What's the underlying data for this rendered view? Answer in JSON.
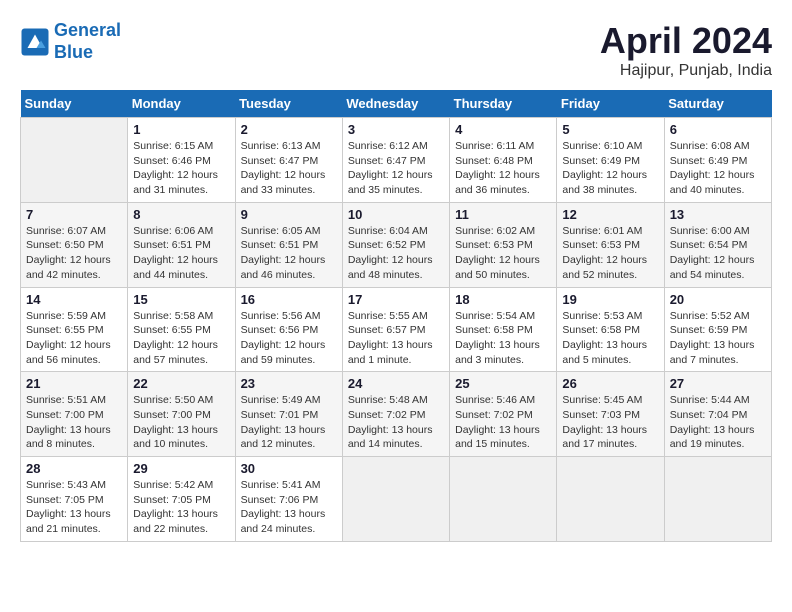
{
  "logo": {
    "line1": "General",
    "line2": "Blue"
  },
  "title": "April 2024",
  "location": "Hajipur, Punjab, India",
  "days_header": [
    "Sunday",
    "Monday",
    "Tuesday",
    "Wednesday",
    "Thursday",
    "Friday",
    "Saturday"
  ],
  "weeks": [
    [
      {
        "num": "",
        "content": ""
      },
      {
        "num": "1",
        "content": "Sunrise: 6:15 AM\nSunset: 6:46 PM\nDaylight: 12 hours\nand 31 minutes."
      },
      {
        "num": "2",
        "content": "Sunrise: 6:13 AM\nSunset: 6:47 PM\nDaylight: 12 hours\nand 33 minutes."
      },
      {
        "num": "3",
        "content": "Sunrise: 6:12 AM\nSunset: 6:47 PM\nDaylight: 12 hours\nand 35 minutes."
      },
      {
        "num": "4",
        "content": "Sunrise: 6:11 AM\nSunset: 6:48 PM\nDaylight: 12 hours\nand 36 minutes."
      },
      {
        "num": "5",
        "content": "Sunrise: 6:10 AM\nSunset: 6:49 PM\nDaylight: 12 hours\nand 38 minutes."
      },
      {
        "num": "6",
        "content": "Sunrise: 6:08 AM\nSunset: 6:49 PM\nDaylight: 12 hours\nand 40 minutes."
      }
    ],
    [
      {
        "num": "7",
        "content": "Sunrise: 6:07 AM\nSunset: 6:50 PM\nDaylight: 12 hours\nand 42 minutes."
      },
      {
        "num": "8",
        "content": "Sunrise: 6:06 AM\nSunset: 6:51 PM\nDaylight: 12 hours\nand 44 minutes."
      },
      {
        "num": "9",
        "content": "Sunrise: 6:05 AM\nSunset: 6:51 PM\nDaylight: 12 hours\nand 46 minutes."
      },
      {
        "num": "10",
        "content": "Sunrise: 6:04 AM\nSunset: 6:52 PM\nDaylight: 12 hours\nand 48 minutes."
      },
      {
        "num": "11",
        "content": "Sunrise: 6:02 AM\nSunset: 6:53 PM\nDaylight: 12 hours\nand 50 minutes."
      },
      {
        "num": "12",
        "content": "Sunrise: 6:01 AM\nSunset: 6:53 PM\nDaylight: 12 hours\nand 52 minutes."
      },
      {
        "num": "13",
        "content": "Sunrise: 6:00 AM\nSunset: 6:54 PM\nDaylight: 12 hours\nand 54 minutes."
      }
    ],
    [
      {
        "num": "14",
        "content": "Sunrise: 5:59 AM\nSunset: 6:55 PM\nDaylight: 12 hours\nand 56 minutes."
      },
      {
        "num": "15",
        "content": "Sunrise: 5:58 AM\nSunset: 6:55 PM\nDaylight: 12 hours\nand 57 minutes."
      },
      {
        "num": "16",
        "content": "Sunrise: 5:56 AM\nSunset: 6:56 PM\nDaylight: 12 hours\nand 59 minutes."
      },
      {
        "num": "17",
        "content": "Sunrise: 5:55 AM\nSunset: 6:57 PM\nDaylight: 13 hours\nand 1 minute."
      },
      {
        "num": "18",
        "content": "Sunrise: 5:54 AM\nSunset: 6:58 PM\nDaylight: 13 hours\nand 3 minutes."
      },
      {
        "num": "19",
        "content": "Sunrise: 5:53 AM\nSunset: 6:58 PM\nDaylight: 13 hours\nand 5 minutes."
      },
      {
        "num": "20",
        "content": "Sunrise: 5:52 AM\nSunset: 6:59 PM\nDaylight: 13 hours\nand 7 minutes."
      }
    ],
    [
      {
        "num": "21",
        "content": "Sunrise: 5:51 AM\nSunset: 7:00 PM\nDaylight: 13 hours\nand 8 minutes."
      },
      {
        "num": "22",
        "content": "Sunrise: 5:50 AM\nSunset: 7:00 PM\nDaylight: 13 hours\nand 10 minutes."
      },
      {
        "num": "23",
        "content": "Sunrise: 5:49 AM\nSunset: 7:01 PM\nDaylight: 13 hours\nand 12 minutes."
      },
      {
        "num": "24",
        "content": "Sunrise: 5:48 AM\nSunset: 7:02 PM\nDaylight: 13 hours\nand 14 minutes."
      },
      {
        "num": "25",
        "content": "Sunrise: 5:46 AM\nSunset: 7:02 PM\nDaylight: 13 hours\nand 15 minutes."
      },
      {
        "num": "26",
        "content": "Sunrise: 5:45 AM\nSunset: 7:03 PM\nDaylight: 13 hours\nand 17 minutes."
      },
      {
        "num": "27",
        "content": "Sunrise: 5:44 AM\nSunset: 7:04 PM\nDaylight: 13 hours\nand 19 minutes."
      }
    ],
    [
      {
        "num": "28",
        "content": "Sunrise: 5:43 AM\nSunset: 7:05 PM\nDaylight: 13 hours\nand 21 minutes."
      },
      {
        "num": "29",
        "content": "Sunrise: 5:42 AM\nSunset: 7:05 PM\nDaylight: 13 hours\nand 22 minutes."
      },
      {
        "num": "30",
        "content": "Sunrise: 5:41 AM\nSunset: 7:06 PM\nDaylight: 13 hours\nand 24 minutes."
      },
      {
        "num": "",
        "content": ""
      },
      {
        "num": "",
        "content": ""
      },
      {
        "num": "",
        "content": ""
      },
      {
        "num": "",
        "content": ""
      }
    ]
  ]
}
